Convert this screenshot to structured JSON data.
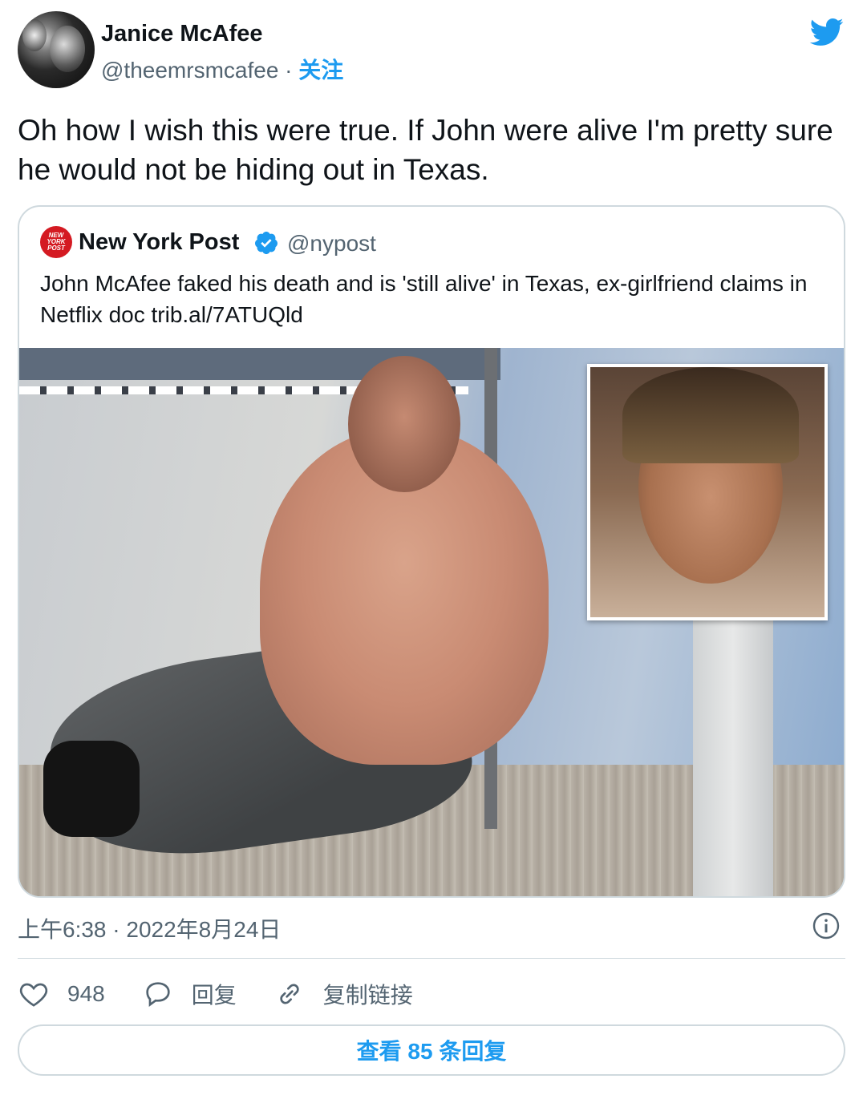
{
  "author": {
    "display_name": "Janice McAfee",
    "handle": "@theemrsmcafee",
    "separator": "·",
    "follow_label": "关注"
  },
  "tweet_text": "Oh how I wish this were true. If John were alive I'm pretty sure he would not be hiding out in Texas.",
  "quoted": {
    "display_name": "New York Post",
    "handle": "@nypost",
    "logo_text": "NEW YORK POST",
    "text": "John McAfee faked his death and is 'still alive' in Texas, ex-girlfriend claims in Netflix doc trib.al/7ATUQld"
  },
  "timestamp": "上午6:38 · 2022年8月24日",
  "actions": {
    "like_count": "948",
    "reply_label": "回复",
    "copy_link_label": "复制链接"
  },
  "view_replies_label": "查看 85 条回复",
  "colors": {
    "brand_blue": "#1d9bf0",
    "text_primary": "#0f1419",
    "text_secondary": "#536471",
    "border": "#cfd9de",
    "nypost_red": "#d41a22"
  },
  "icons": {
    "bird": "twitter-bird-icon",
    "verified": "verified-badge-icon",
    "info": "info-icon",
    "like": "heart-icon",
    "reply": "speech-bubble-icon",
    "copy_link": "link-icon"
  }
}
